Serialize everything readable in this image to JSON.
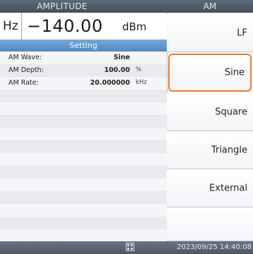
{
  "amplitude": {
    "header": "AMPLITUDE",
    "unit_left": "Hz",
    "value": "−140.00",
    "unit": "dBm"
  },
  "setting": {
    "header": "Setting",
    "rows": [
      {
        "label": "AM Wave:",
        "value": "Sine",
        "unit": ""
      },
      {
        "label": "AM Depth:",
        "value": "100.00",
        "unit": "%"
      },
      {
        "label": "AM Rate:",
        "value": "20.000000",
        "unit": "kHz"
      }
    ]
  },
  "softkeys": {
    "header": "AM",
    "items": [
      "LF",
      "Sine",
      "Square",
      "Triangle",
      "External",
      ""
    ],
    "selected_index": 1,
    "accent": "#e87a2c"
  },
  "status": {
    "datetime": "2023/09/25 14:40:08",
    "icon": "network-icon"
  }
}
